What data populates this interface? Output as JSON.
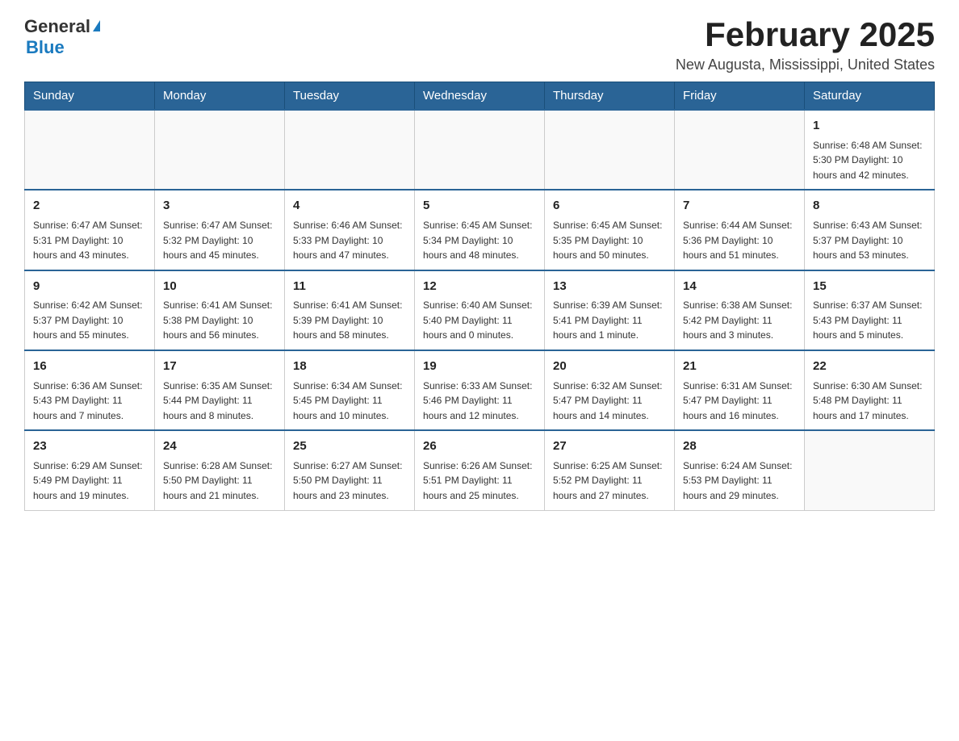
{
  "header": {
    "logo": {
      "general": "General",
      "blue": "Blue"
    },
    "title": "February 2025",
    "location": "New Augusta, Mississippi, United States"
  },
  "days_of_week": [
    "Sunday",
    "Monday",
    "Tuesday",
    "Wednesday",
    "Thursday",
    "Friday",
    "Saturday"
  ],
  "weeks": [
    {
      "days": [
        {
          "number": "",
          "info": ""
        },
        {
          "number": "",
          "info": ""
        },
        {
          "number": "",
          "info": ""
        },
        {
          "number": "",
          "info": ""
        },
        {
          "number": "",
          "info": ""
        },
        {
          "number": "",
          "info": ""
        },
        {
          "number": "1",
          "info": "Sunrise: 6:48 AM\nSunset: 5:30 PM\nDaylight: 10 hours and 42 minutes."
        }
      ]
    },
    {
      "days": [
        {
          "number": "2",
          "info": "Sunrise: 6:47 AM\nSunset: 5:31 PM\nDaylight: 10 hours and 43 minutes."
        },
        {
          "number": "3",
          "info": "Sunrise: 6:47 AM\nSunset: 5:32 PM\nDaylight: 10 hours and 45 minutes."
        },
        {
          "number": "4",
          "info": "Sunrise: 6:46 AM\nSunset: 5:33 PM\nDaylight: 10 hours and 47 minutes."
        },
        {
          "number": "5",
          "info": "Sunrise: 6:45 AM\nSunset: 5:34 PM\nDaylight: 10 hours and 48 minutes."
        },
        {
          "number": "6",
          "info": "Sunrise: 6:45 AM\nSunset: 5:35 PM\nDaylight: 10 hours and 50 minutes."
        },
        {
          "number": "7",
          "info": "Sunrise: 6:44 AM\nSunset: 5:36 PM\nDaylight: 10 hours and 51 minutes."
        },
        {
          "number": "8",
          "info": "Sunrise: 6:43 AM\nSunset: 5:37 PM\nDaylight: 10 hours and 53 minutes."
        }
      ]
    },
    {
      "days": [
        {
          "number": "9",
          "info": "Sunrise: 6:42 AM\nSunset: 5:37 PM\nDaylight: 10 hours and 55 minutes."
        },
        {
          "number": "10",
          "info": "Sunrise: 6:41 AM\nSunset: 5:38 PM\nDaylight: 10 hours and 56 minutes."
        },
        {
          "number": "11",
          "info": "Sunrise: 6:41 AM\nSunset: 5:39 PM\nDaylight: 10 hours and 58 minutes."
        },
        {
          "number": "12",
          "info": "Sunrise: 6:40 AM\nSunset: 5:40 PM\nDaylight: 11 hours and 0 minutes."
        },
        {
          "number": "13",
          "info": "Sunrise: 6:39 AM\nSunset: 5:41 PM\nDaylight: 11 hours and 1 minute."
        },
        {
          "number": "14",
          "info": "Sunrise: 6:38 AM\nSunset: 5:42 PM\nDaylight: 11 hours and 3 minutes."
        },
        {
          "number": "15",
          "info": "Sunrise: 6:37 AM\nSunset: 5:43 PM\nDaylight: 11 hours and 5 minutes."
        }
      ]
    },
    {
      "days": [
        {
          "number": "16",
          "info": "Sunrise: 6:36 AM\nSunset: 5:43 PM\nDaylight: 11 hours and 7 minutes."
        },
        {
          "number": "17",
          "info": "Sunrise: 6:35 AM\nSunset: 5:44 PM\nDaylight: 11 hours and 8 minutes."
        },
        {
          "number": "18",
          "info": "Sunrise: 6:34 AM\nSunset: 5:45 PM\nDaylight: 11 hours and 10 minutes."
        },
        {
          "number": "19",
          "info": "Sunrise: 6:33 AM\nSunset: 5:46 PM\nDaylight: 11 hours and 12 minutes."
        },
        {
          "number": "20",
          "info": "Sunrise: 6:32 AM\nSunset: 5:47 PM\nDaylight: 11 hours and 14 minutes."
        },
        {
          "number": "21",
          "info": "Sunrise: 6:31 AM\nSunset: 5:47 PM\nDaylight: 11 hours and 16 minutes."
        },
        {
          "number": "22",
          "info": "Sunrise: 6:30 AM\nSunset: 5:48 PM\nDaylight: 11 hours and 17 minutes."
        }
      ]
    },
    {
      "days": [
        {
          "number": "23",
          "info": "Sunrise: 6:29 AM\nSunset: 5:49 PM\nDaylight: 11 hours and 19 minutes."
        },
        {
          "number": "24",
          "info": "Sunrise: 6:28 AM\nSunset: 5:50 PM\nDaylight: 11 hours and 21 minutes."
        },
        {
          "number": "25",
          "info": "Sunrise: 6:27 AM\nSunset: 5:50 PM\nDaylight: 11 hours and 23 minutes."
        },
        {
          "number": "26",
          "info": "Sunrise: 6:26 AM\nSunset: 5:51 PM\nDaylight: 11 hours and 25 minutes."
        },
        {
          "number": "27",
          "info": "Sunrise: 6:25 AM\nSunset: 5:52 PM\nDaylight: 11 hours and 27 minutes."
        },
        {
          "number": "28",
          "info": "Sunrise: 6:24 AM\nSunset: 5:53 PM\nDaylight: 11 hours and 29 minutes."
        },
        {
          "number": "",
          "info": ""
        }
      ]
    }
  ]
}
